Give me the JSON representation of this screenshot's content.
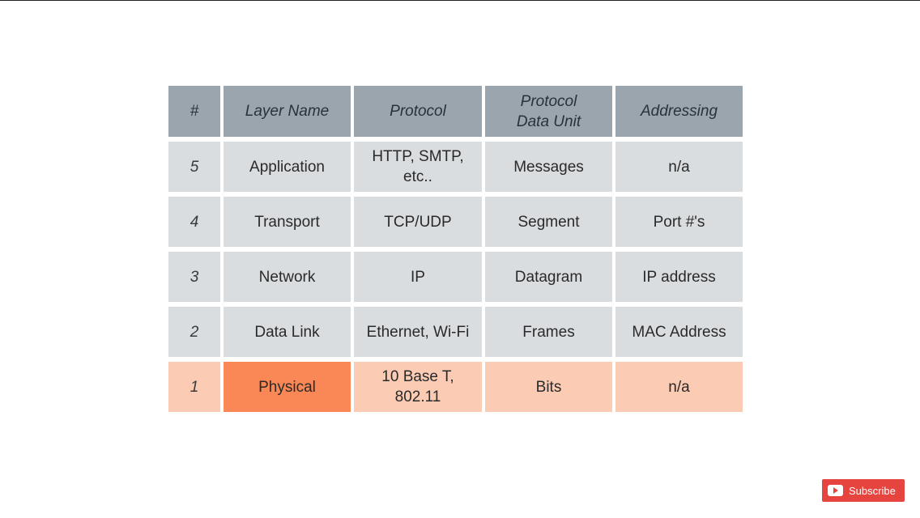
{
  "table": {
    "headers": {
      "num": "#",
      "layer_name": "Layer Name",
      "protocol": "Protocol",
      "pdu": "Protocol\nData Unit",
      "addressing": "Addressing"
    },
    "rows": [
      {
        "num": "5",
        "layer_name": "Application",
        "protocol": "HTTP, SMTP,\netc..",
        "pdu": "Messages",
        "addressing": "n/a"
      },
      {
        "num": "4",
        "layer_name": "Transport",
        "protocol": "TCP/UDP",
        "pdu": "Segment",
        "addressing": "Port #'s"
      },
      {
        "num": "3",
        "layer_name": "Network",
        "protocol": "IP",
        "pdu": "Datagram",
        "addressing": "IP address"
      },
      {
        "num": "2",
        "layer_name": "Data Link",
        "protocol": "Ethernet, Wi-Fi",
        "pdu": "Frames",
        "addressing": "MAC Address"
      },
      {
        "num": "1",
        "layer_name": "Physical",
        "protocol": "10 Base T,\n802.11",
        "pdu": "Bits",
        "addressing": "n/a"
      }
    ],
    "highlighted_row": "1"
  },
  "subscribe": {
    "label": "Subscribe",
    "icon": "youtube-play-icon"
  },
  "colors": {
    "header_bg": "#9aa5ae",
    "row_bg": "#dadde0",
    "highlight_row_bg": "#fbcbb4",
    "highlight_cell_bg": "#f98856",
    "subscribe_bg": "#e6443f"
  }
}
